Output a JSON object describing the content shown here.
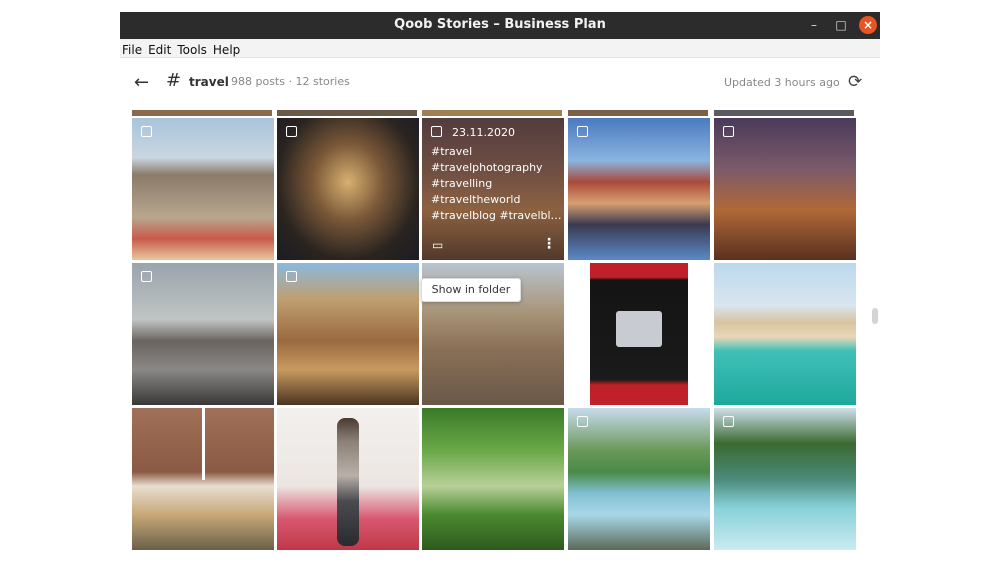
{
  "window": {
    "title": "Qoob Stories – Business Plan"
  },
  "menu": [
    "File",
    "Edit",
    "Tools",
    "Help"
  ],
  "toolbar": {
    "tag": "travel",
    "meta": "988 posts · 12 stories",
    "updated": "Updated 3 hours ago"
  },
  "hovered_post": {
    "date": "23.11.2020",
    "hashtags": [
      "#travel",
      "#travelphotography",
      "#travelling",
      "#traveltheworld",
      "#travelblog #travelbl…"
    ]
  },
  "tooltip": "Show in folder",
  "posts": [
    {
      "subject": "grand-place-flower-carpet-photo"
    },
    {
      "subject": "night-square-photo"
    },
    {
      "subject": "hovered-post"
    },
    {
      "subject": "canal-houses-reflection-photo"
    },
    {
      "subject": "church-night-photo"
    },
    {
      "subject": "atomium-reflection-photo"
    },
    {
      "subject": "guildhalls-reflection-photo"
    },
    {
      "subject": "basilica-street-photo"
    },
    {
      "subject": "ad-poster-image"
    },
    {
      "subject": "beach-dune-photo"
    },
    {
      "subject": "collage-photo"
    },
    {
      "subject": "man-red-field-photo"
    },
    {
      "subject": "forest-lake-photo"
    },
    {
      "subject": "waterfall-woman-photo"
    },
    {
      "subject": "river-rapids-photo"
    }
  ]
}
